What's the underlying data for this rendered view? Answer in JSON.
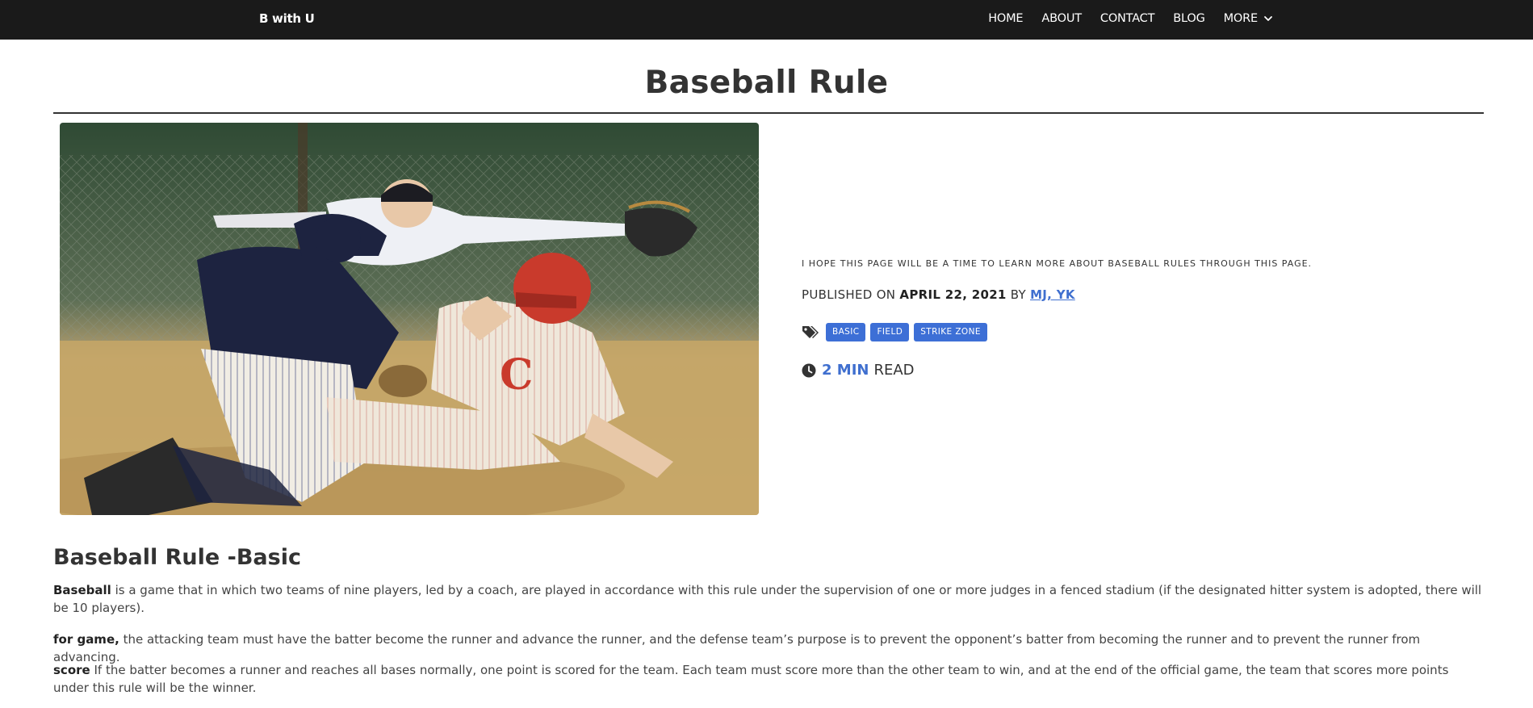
{
  "nav": {
    "brand": "B with U",
    "links": [
      "HOME",
      "ABOUT",
      "CONTACT",
      "BLOG",
      "MORE"
    ]
  },
  "page": {
    "title": "Baseball Rule"
  },
  "hero": {
    "description": "Baseball photo: a runner in a red helmet sliding into home plate while the catcher tags him and the umpire signals safe"
  },
  "meta": {
    "intro": "I HOPE THIS PAGE WILL BE A TIME TO LEARN MORE ABOUT BASEBALL RULES THROUGH THIS PAGE.",
    "published_prefix": "PUBLISHED ON",
    "date": "APRIL 22, 2021",
    "by": "BY",
    "author": "MJ, YK",
    "tags": [
      "BASIC",
      "FIELD",
      "STRIKE ZONE"
    ],
    "read_minutes": "2 MIN",
    "read_label": "READ"
  },
  "content": {
    "heading": "Baseball Rule -Basic",
    "paragraphs": [
      {
        "lead": "Baseball",
        "text": " is a game that in which two teams of nine players, led by a coach, are played in accordance with this rule under the supervision of one or more judges in a fenced stadium (if the designated hitter system is adopted, there will be 10 players)."
      },
      {
        "lead": "for game,",
        "text": " the attacking team must have the batter become the runner and advance the runner, and the defense team’s purpose is to prevent the opponent’s batter from becoming the runner and to prevent the runner from advancing."
      },
      {
        "lead": "score",
        "text": " If the batter becomes a runner and reaches all bases normally, one point is scored for the team. Each team must score more than the other team to win, and at the end of the official game, the team that scores more points under this rule will be the winner."
      }
    ]
  },
  "colors": {
    "navbar": "#1a1a1a",
    "accent": "#3d6fd6",
    "text": "#333333"
  },
  "icons": [
    "chevron-down-icon",
    "tags-icon",
    "clock-icon"
  ]
}
